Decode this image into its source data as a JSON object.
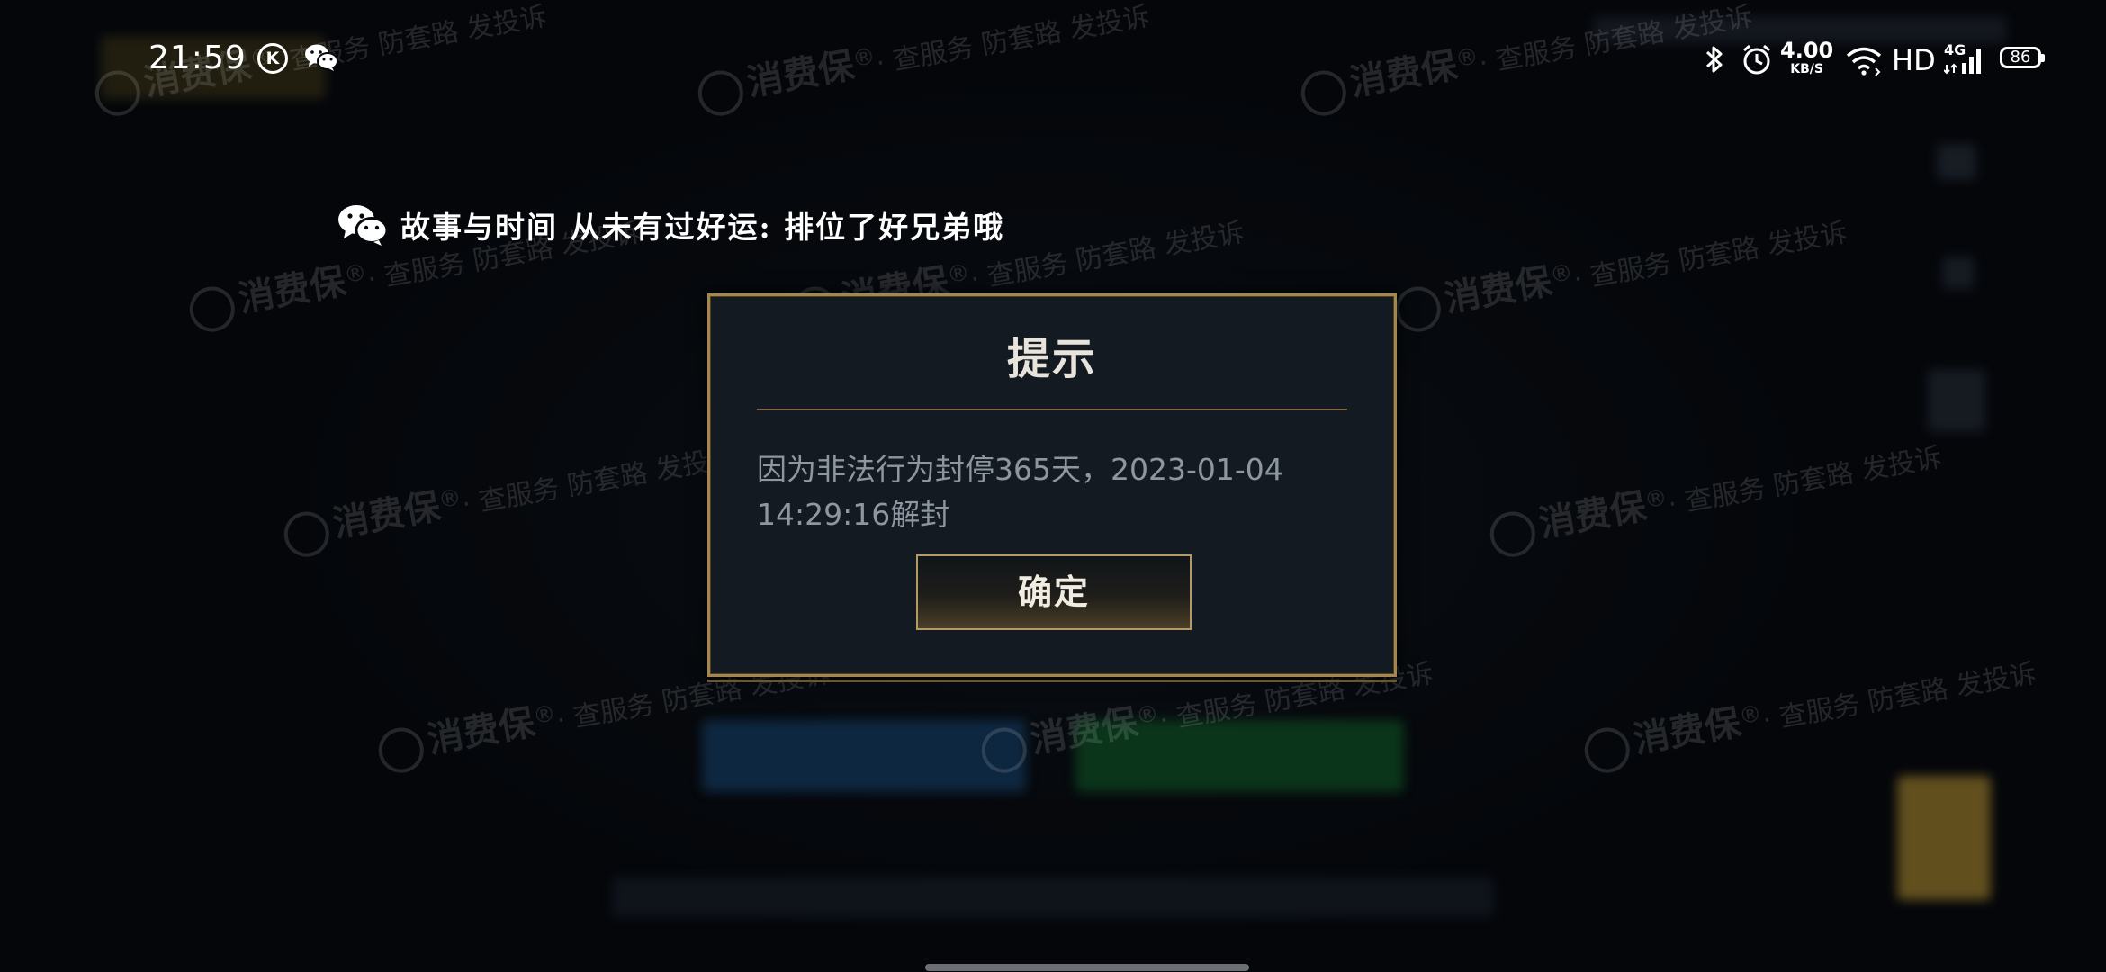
{
  "status_bar": {
    "time": "21:59",
    "k_icon_letter": "K",
    "net_speed_value": "4.00",
    "net_speed_unit": "KB/S",
    "hd_label": "HD",
    "signal_label": "4G",
    "battery": "86"
  },
  "notification": {
    "text": "故事与时间 从未有过好运: 排位了好兄弟哦"
  },
  "dialog": {
    "title": "提示",
    "message_line1": "因为非法行为封停365天，2023-01-04",
    "message_line2": "14:29:16解封",
    "confirm_label": "确定"
  },
  "watermark": {
    "brand": "消费保",
    "registered": "®",
    "slogan": "· 查服务 防套路 发投诉"
  },
  "colors": {
    "dialog_border": "#a5864f",
    "dialog_bg": "#131a22",
    "message_text": "#8e969f"
  }
}
